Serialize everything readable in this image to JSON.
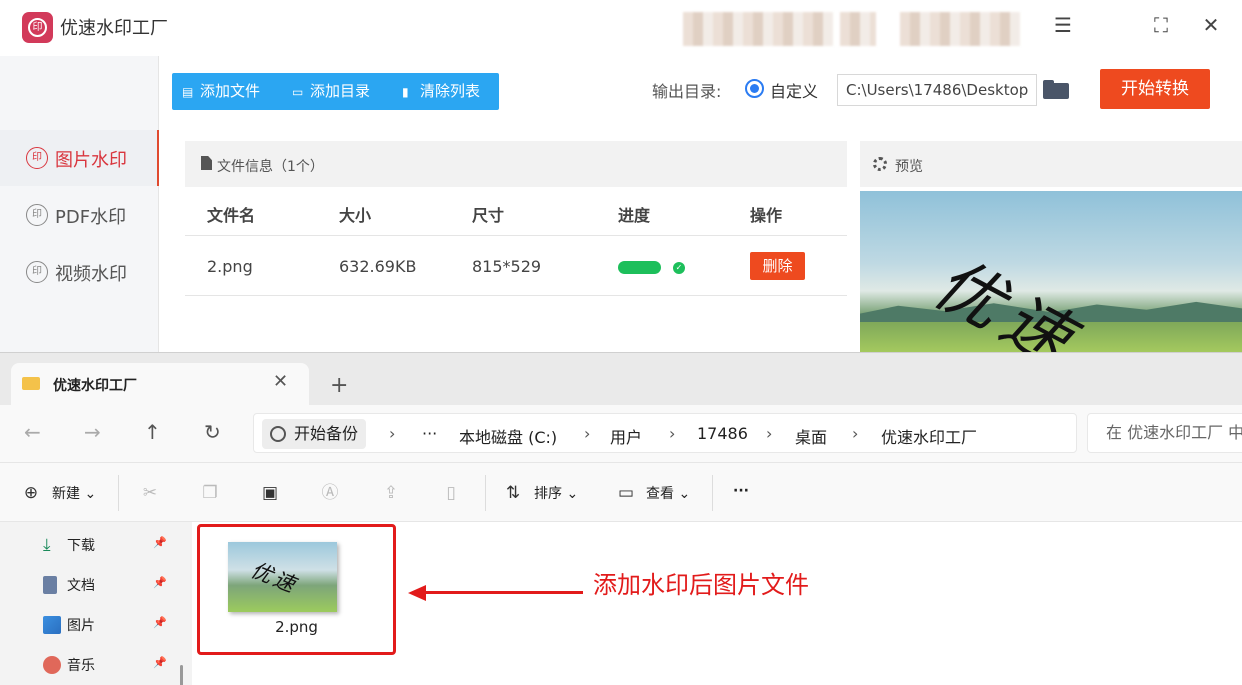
{
  "app": {
    "title": "优速水印工厂",
    "window_controls": [
      "menu-icon",
      "maximize-icon",
      "close-icon"
    ]
  },
  "sidebar": {
    "items": [
      {
        "label": "图片水印",
        "active": true
      },
      {
        "label": "PDF水印",
        "active": false
      },
      {
        "label": "视频水印",
        "active": false
      }
    ]
  },
  "toolbar": {
    "add_file": "添加文件",
    "add_dir": "添加目录",
    "clear_list": "清除列表"
  },
  "output": {
    "label": "输出目录:",
    "radio_label": "自定义",
    "path": "C:\\Users\\17486\\Desktop",
    "start_label": "开始转换"
  },
  "file_panel": {
    "title": "文件信息（1个）",
    "columns": [
      "文件名",
      "大小",
      "尺寸",
      "进度",
      "操作"
    ],
    "rows": [
      {
        "name": "2.png",
        "size": "632.69KB",
        "dims": "815*529",
        "progress": 1.0,
        "action": "删除"
      }
    ]
  },
  "preview": {
    "title": "预览",
    "watermark_text": "优速"
  },
  "explorer": {
    "tab_title": "优速水印工厂",
    "backup_label": "开始备份",
    "breadcrumbs": [
      "本地磁盘 (C:)",
      "用户",
      "17486",
      "桌面",
      "优速水印工厂"
    ],
    "ellipsis": "···",
    "search_placeholder": "在 优速水印工厂 中",
    "commands": {
      "new": "新建",
      "sort": "排序",
      "view": "查看",
      "more": "···"
    },
    "nav_items": [
      {
        "label": "下载",
        "icon": "download-icon"
      },
      {
        "label": "文档",
        "icon": "document-icon"
      },
      {
        "label": "图片",
        "icon": "picture-icon"
      },
      {
        "label": "音乐",
        "icon": "music-icon"
      }
    ],
    "file": {
      "name": "2.png",
      "watermark_text": "优速"
    }
  },
  "annotation": {
    "text": "添加水印后图片文件"
  },
  "colors": {
    "accent_blue": "#2ba6f2",
    "accent_orange": "#ee4a1f",
    "progress_green": "#1dbf5b",
    "annotation_red": "#e21b1b"
  }
}
